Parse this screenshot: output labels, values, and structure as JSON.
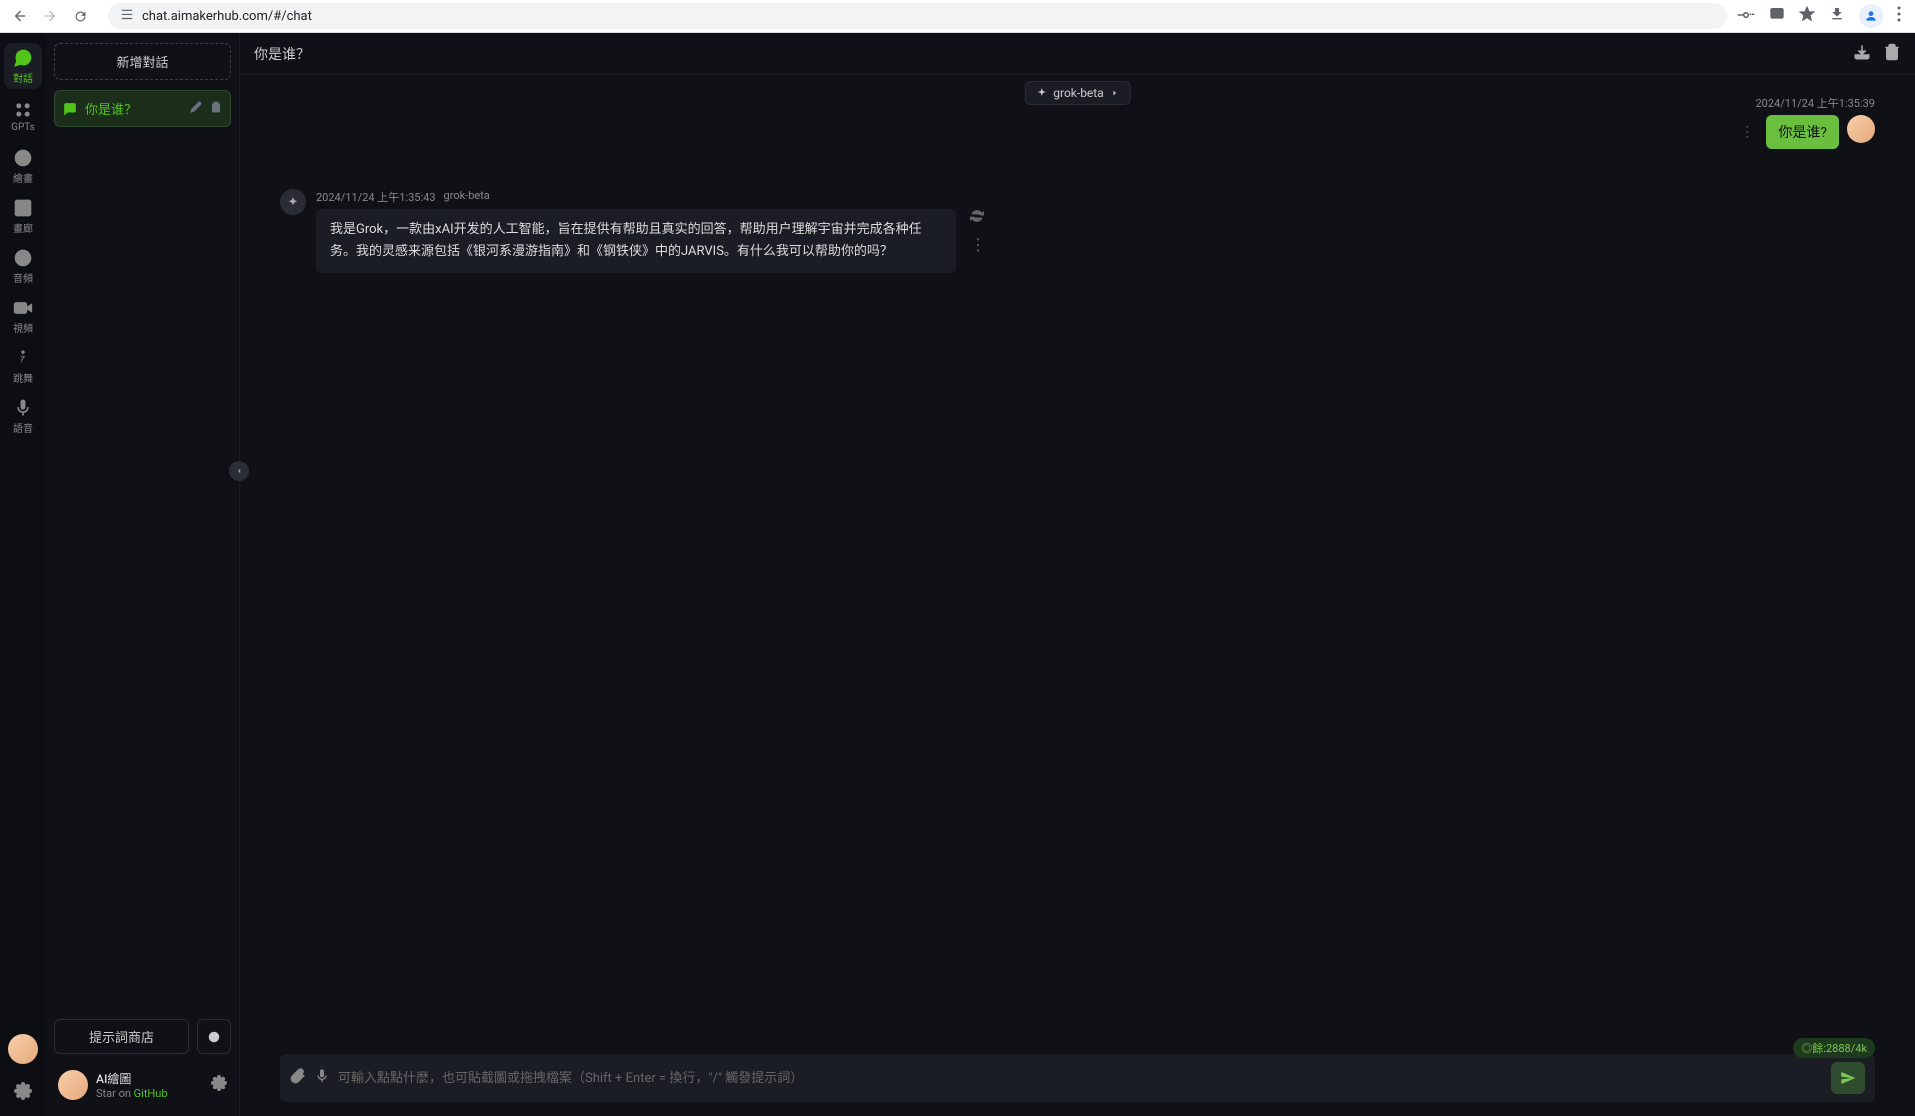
{
  "browser": {
    "url": "chat.aimakerhub.com/#/chat"
  },
  "rail": {
    "items": [
      {
        "label": "對話",
        "icon": "chat"
      },
      {
        "label": "GPTs",
        "icon": "grid"
      },
      {
        "label": "繪畫",
        "icon": "palette"
      },
      {
        "label": "畫廊",
        "icon": "image"
      },
      {
        "label": "音頻",
        "icon": "audio"
      },
      {
        "label": "視頻",
        "icon": "video"
      },
      {
        "label": "跳舞",
        "icon": "dance"
      },
      {
        "label": "語音",
        "icon": "mic"
      }
    ]
  },
  "sidebar": {
    "new_chat": "新增對話",
    "conversations": [
      {
        "title": "你是谁？"
      }
    ],
    "prompt_store": "提示詞商店",
    "footer": {
      "title": "AI繪圖",
      "star_prefix": "Star on ",
      "github": "GitHub"
    }
  },
  "chat": {
    "title": "你是谁？",
    "model": "grok-beta",
    "user_msg": {
      "timestamp": "2024/11/24 上午1:35:39",
      "text": "你是谁?"
    },
    "asst_msg": {
      "timestamp": "2024/11/24 上午1:35:43",
      "model": "grok-beta",
      "text": "我是Grok，一款由xAI开发的人工智能，旨在提供有帮助且真实的回答，帮助用户理解宇宙并完成各种任务。我的灵感来源包括《银河系漫游指南》和《钢铁侠》中的JARVIS。有什么我可以帮助你的吗？"
    },
    "token_badge": "◎餘:2888/4k",
    "input_placeholder": "可輸入點點什麼，也可貼截圖或拖拽檔案（Shift + Enter = 換行，\"/\" 觸發提示詞）"
  }
}
